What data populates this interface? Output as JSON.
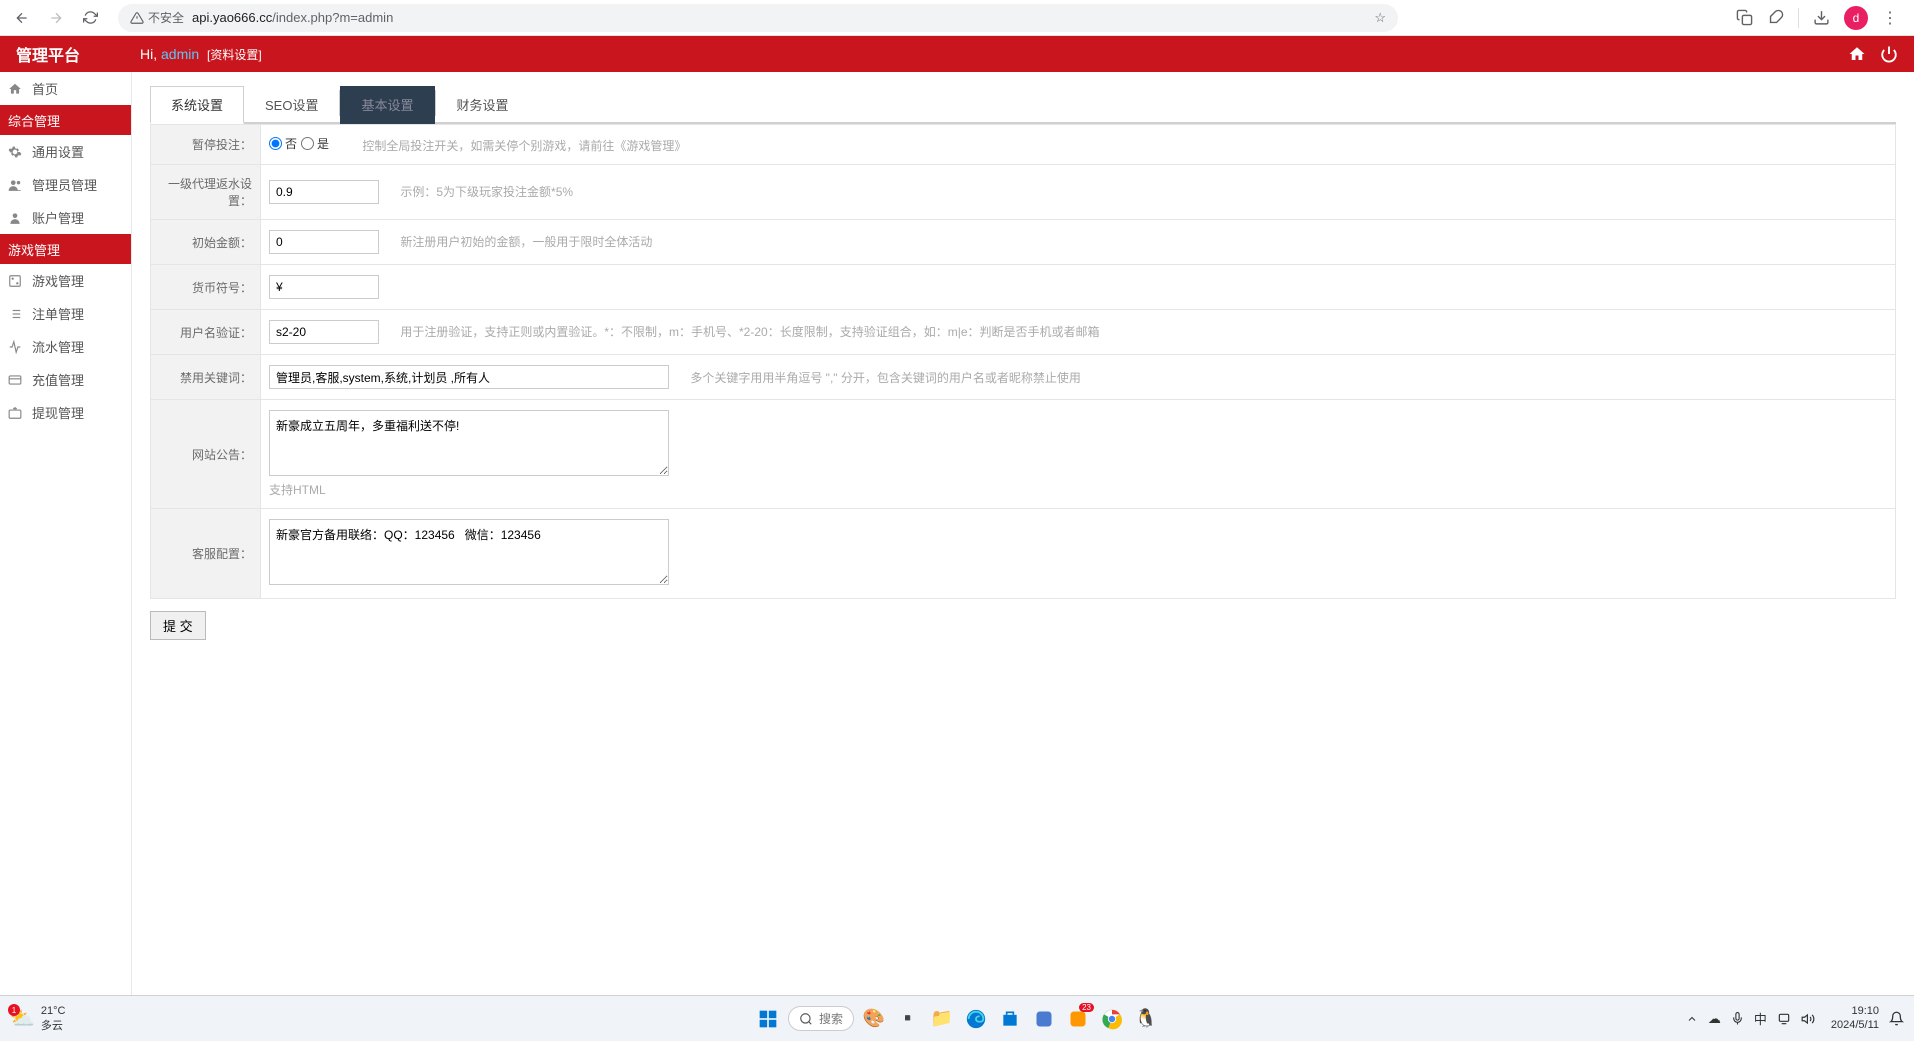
{
  "browser": {
    "insecure_label": "不安全",
    "url_host": "api.yao666.cc",
    "url_path": "/index.php?m=admin"
  },
  "header": {
    "app_title": "管理平台",
    "greeting_prefix": "Hi, ",
    "username": "admin",
    "context": "[资料设置]"
  },
  "sidebar": {
    "items": [
      {
        "icon": "home",
        "label": "首页"
      },
      {
        "section": true,
        "label": "综合管理"
      },
      {
        "icon": "gear",
        "label": "通用设置"
      },
      {
        "icon": "user",
        "label": "管理员管理"
      },
      {
        "icon": "person",
        "label": "账户管理"
      },
      {
        "section": true,
        "label": "游戏管理"
      },
      {
        "icon": "dice",
        "label": "游戏管理"
      },
      {
        "icon": "list",
        "label": "注单管理"
      },
      {
        "icon": "flow",
        "label": "流水管理"
      },
      {
        "icon": "card",
        "label": "充值管理"
      },
      {
        "icon": "withdraw",
        "label": "提现管理"
      }
    ]
  },
  "tabs": [
    {
      "label": "系统设置",
      "active": true
    },
    {
      "label": "SEO设置"
    },
    {
      "label": "基本设置",
      "dark": true
    },
    {
      "label": "财务设置"
    }
  ],
  "form": {
    "pause_label": "暂停投注：",
    "pause_no": "否",
    "pause_yes": "是",
    "pause_hint": "控制全局投注开关，如需关停个别游戏，请前往《游戏管理》",
    "rebate_label": "一级代理返水设置：",
    "rebate_value": "0.9",
    "rebate_hint": "示例：5为下级玩家投注金额*5%",
    "initial_label": "初始金额：",
    "initial_value": "0",
    "initial_hint": "新注册用户初始的金额，一般用于限时全体活动",
    "currency_label": "货币符号：",
    "currency_value": "¥",
    "username_label": "用户名验证：",
    "username_value": "s2-20",
    "username_hint": "用于注册验证，支持正则或内置验证。*：不限制，m：手机号、*2-20：长度限制，支持验证组合，如：m|e：判断是否手机或者邮箱",
    "banned_label": "禁用关键词：",
    "banned_value": "管理员,客服,system,系统,计划员 ,所有人",
    "banned_hint": "多个关键字用用半角逗号 \",\" 分开，包含关键词的用户名或者昵称禁止使用",
    "notice_label": "网站公告：",
    "notice_value": "新豪成立五周年，多重福利送不停!",
    "notice_hint": "支持HTML",
    "service_label": "客服配置：",
    "service_value": "新豪官方备用联络：QQ：123456   微信：123456",
    "submit": "提 交"
  },
  "taskbar": {
    "temp": "21°C",
    "weather": "多云",
    "search": "搜索",
    "time": "19:10",
    "date": "2024/5/11"
  }
}
